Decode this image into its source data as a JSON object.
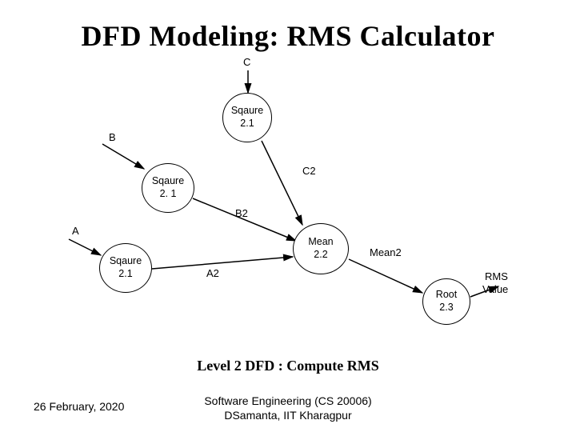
{
  "title": "DFD Modeling: RMS Calculator",
  "caption": "Level 2 DFD : Compute RMS",
  "footer": {
    "date": "26 February, 2020",
    "course_line1": "Software Engineering (CS 20006)",
    "course_line2": "DSamanta, IIT Kharagpur"
  },
  "nodes": {
    "sq_top": {
      "line1": "Sqaure",
      "line2": "2.1"
    },
    "sq_mid": {
      "line1": "Sqaure",
      "line2": "2. 1"
    },
    "sq_bot": {
      "line1": "Sqaure",
      "line2": "2.1"
    },
    "mean": {
      "line1": "Mean",
      "line2": "2.2"
    },
    "root": {
      "line1": "Root",
      "line2": "2.3"
    }
  },
  "labels": {
    "A": "A",
    "B": "B",
    "C": "C",
    "A2": "A2",
    "B2": "B2",
    "C2": "C2",
    "Mean2": "Mean2",
    "RMS": "RMS",
    "Value": "Value"
  }
}
